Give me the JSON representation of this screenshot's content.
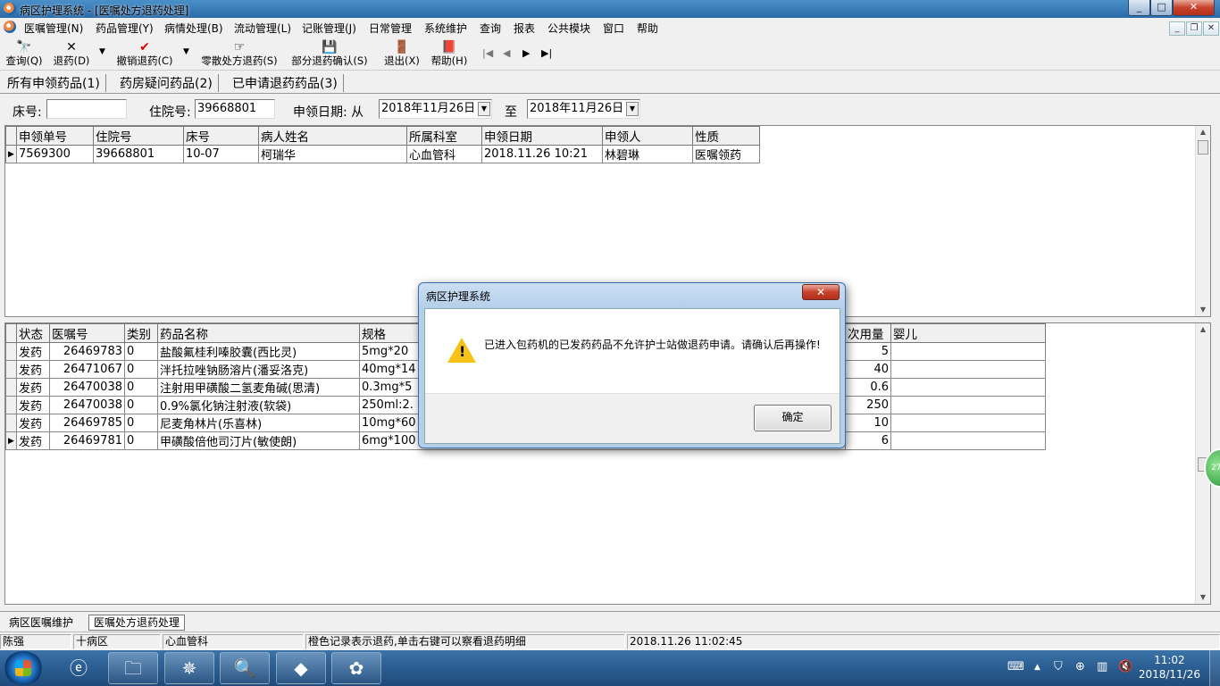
{
  "window": {
    "title": "病区护理系统 - [医嘱处方退药处理]",
    "min_label": "_",
    "max_label": "□",
    "close_label": "✕"
  },
  "menu": [
    "医嘱管理(N)",
    "药品管理(Y)",
    "病情处理(B)",
    "流动管理(L)",
    "记账管理(J)",
    "日常管理",
    "系统维护",
    "查询",
    "报表",
    "公共模块",
    "窗口",
    "帮助"
  ],
  "toolbar": {
    "query": "查询(Q)",
    "return": "退药(D)",
    "cancel_return": "撤销退药(C)",
    "scatter_return": "零散处方退药(S)",
    "partial_confirm": "部分退药确认(S)",
    "exit": "退出(X)",
    "help": "帮助(H)"
  },
  "tabs": [
    "所有申领药品(1)",
    "药房疑问药品(2)",
    "已申请退药药品(3)"
  ],
  "filter": {
    "bed_label": "床号:",
    "bed_value": "",
    "inpatient_label": "住院号:",
    "inpatient_value": "39668801",
    "date_label": "申领日期: 从",
    "date_from": "2018年11月26日",
    "to_label": "至",
    "date_to": "2018年11月26日"
  },
  "upper_table": {
    "headers": [
      "申领单号",
      "住院号",
      "床号",
      "病人姓名",
      "所属科室",
      "申领日期",
      "申领人",
      "性质"
    ],
    "rows": [
      [
        "7569300",
        "39668801",
        "10-07",
        "柯瑞华",
        "心血管科",
        "2018.11.26 10:21",
        "林碧琳",
        "医嘱领药"
      ]
    ]
  },
  "lower_table": {
    "headers": [
      "状态",
      "医嘱号",
      "类别",
      "药品名称",
      "规格",
      "次用量",
      "婴儿"
    ],
    "rows": [
      {
        "status": "发药",
        "order_no": "26469783",
        "cat": "0",
        "name": "盐酸氟桂利嗪胶囊(西比灵)",
        "spec": "5mg*20",
        "dose": "5",
        "baby": ""
      },
      {
        "status": "发药",
        "order_no": "26471067",
        "cat": "0",
        "name": "泮托拉唑钠肠溶片(潘妥洛克)",
        "spec": "40mg*14",
        "dose": "40",
        "baby": ""
      },
      {
        "status": "发药",
        "order_no": "26470038",
        "cat": "0",
        "name": "注射用甲磺酸二氢麦角碱(思清)",
        "spec": "0.3mg*5",
        "dose": "0.6",
        "baby": ""
      },
      {
        "status": "发药",
        "order_no": "26470038",
        "cat": "0",
        "name": "0.9%氯化钠注射液(软袋)",
        "spec": "250ml:2.",
        "dose": "250",
        "baby": ""
      },
      {
        "status": "发药",
        "order_no": "26469785",
        "cat": "0",
        "name": "尼麦角林片(乐喜林)",
        "spec": "10mg*60",
        "dose": "10",
        "baby": ""
      },
      {
        "status": "发药",
        "order_no": "26469781",
        "cat": "0",
        "name": "甲磺酸倍他司汀片(敏使朗)",
        "spec": "6mg*100",
        "dose": "6",
        "baby": ""
      }
    ]
  },
  "dialog": {
    "title": "病区护理系统",
    "message": "已进入包药机的已发药药品不允许护士站做退药申请。请确认后再操作!",
    "ok": "确定",
    "icon": "warning-icon"
  },
  "doc_tabs": [
    "病区医嘱维护",
    "医嘱处方退药处理"
  ],
  "status": {
    "user": "陈强",
    "ward": "十病区",
    "dept": "心血管科",
    "hint": "橙色记录表示退药,单击右键可以察看退药明细",
    "datetime": "2018.11.26 11:02:45"
  },
  "taskbar": {
    "apps": [
      "ie-icon",
      "folder-icon",
      "compass-icon",
      "sql-icon",
      "yellow-app-icon",
      "green-app-icon"
    ],
    "time": "11:02",
    "date": "2018/11/26"
  },
  "side_badge": "27"
}
